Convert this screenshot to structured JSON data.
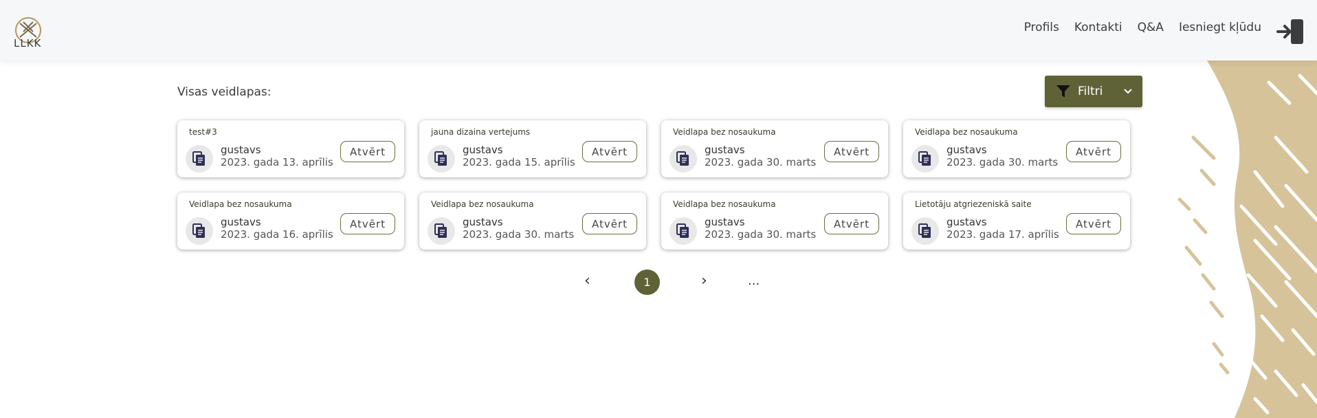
{
  "header": {
    "logo_text": "LLKK",
    "nav": [
      {
        "label": "Profils"
      },
      {
        "label": "Kontakti"
      },
      {
        "label": "Q&A"
      },
      {
        "label": "Iesniegt kļūdu"
      }
    ]
  },
  "main": {
    "section_title": "Visas veidlapas:",
    "filter_label": "Filtri",
    "forms": [
      {
        "title": "test#3",
        "user": "gustavs",
        "date": "2023. gada 13. aprīlis",
        "open": "Atvērt"
      },
      {
        "title": "jauna dizaina vertejums",
        "user": "gustavs",
        "date": "2023. gada 15. aprīlis",
        "open": "Atvērt"
      },
      {
        "title": "Veidlapa bez nosaukuma",
        "user": "gustavs",
        "date": "2023. gada 30. marts",
        "open": "Atvērt"
      },
      {
        "title": "Veidlapa bez nosaukuma",
        "user": "gustavs",
        "date": "2023. gada 30. marts",
        "open": "Atvērt"
      },
      {
        "title": "Veidlapa bez nosaukuma",
        "user": "gustavs",
        "date": "2023. gada 16. aprīlis",
        "open": "Atvērt"
      },
      {
        "title": "Veidlapa bez nosaukuma",
        "user": "gustavs",
        "date": "2023. gada 30. marts",
        "open": "Atvērt"
      },
      {
        "title": "Veidlapa bez nosaukuma",
        "user": "gustavs",
        "date": "2023. gada 30. marts",
        "open": "Atvērt"
      },
      {
        "title": "Lietotāju atgriezeniskā saite",
        "user": "gustavs",
        "date": "2023. gada 17. aprīlis",
        "open": "Atvērt"
      }
    ]
  },
  "pagination": {
    "prev": "‹",
    "current": "1",
    "next": "›",
    "more": "..."
  },
  "colors": {
    "accent": "#5f6236",
    "decor": "#d6c39a",
    "icon": "#2e2f5a"
  },
  "icons": {
    "logo": "llkk-logo-icon",
    "logout": "logout-door-icon",
    "filter": "funnel-icon",
    "chevron": "chevron-down-icon",
    "file": "copy-document-icon"
  }
}
